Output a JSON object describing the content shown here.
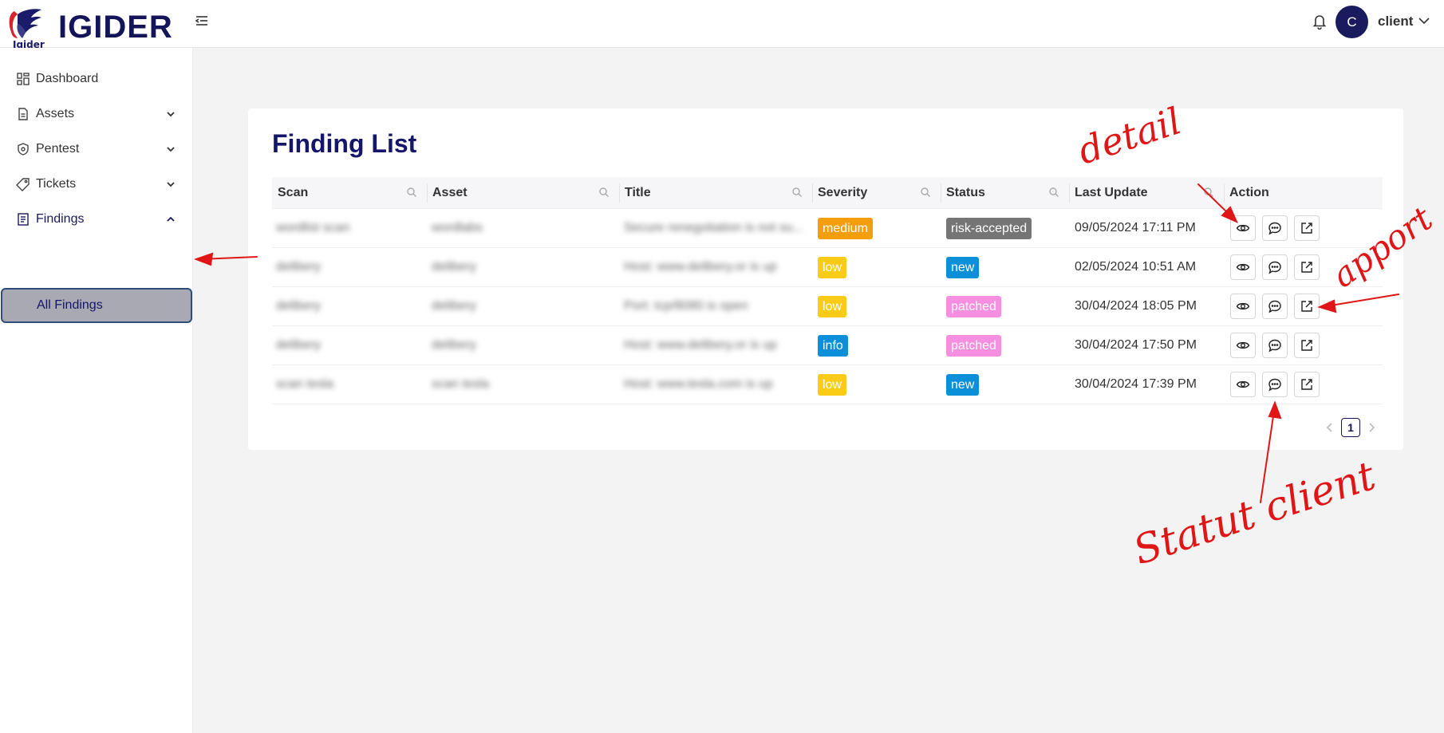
{
  "brand": {
    "name": "IGIDER",
    "logo_text": "Igider"
  },
  "header": {
    "avatar_initial": "C",
    "username": "client"
  },
  "sidebar": {
    "items": [
      {
        "label": "Dashboard",
        "icon": "dashboard-icon"
      },
      {
        "label": "Assets",
        "icon": "file-icon"
      },
      {
        "label": "Pentest",
        "icon": "shield-icon"
      },
      {
        "label": "Tickets",
        "icon": "tag-icon"
      },
      {
        "label": "Findings",
        "icon": "list-icon"
      }
    ],
    "sub_item": "All Findings"
  },
  "main": {
    "title": "Finding List",
    "columns": [
      "Scan",
      "Asset",
      "Title",
      "Severity",
      "Status",
      "Last Update",
      "Action"
    ],
    "rows": [
      {
        "scan": "wordlist scan",
        "asset": "wordlabs",
        "title": "Secure renegotiation is not su...",
        "severity": "medium",
        "status": "risk-accepted",
        "updated": "09/05/2024 17:11 PM"
      },
      {
        "scan": "delibery",
        "asset": "delibery",
        "title": "Host: www.delibery.or is up",
        "severity": "low",
        "status": "new",
        "updated": "02/05/2024 10:51 AM"
      },
      {
        "scan": "delibery",
        "asset": "delibery",
        "title": "Port: tcp/8080 is open",
        "severity": "low",
        "status": "patched",
        "updated": "30/04/2024 18:05 PM"
      },
      {
        "scan": "delibery",
        "asset": "delibery",
        "title": "Host: www.delibery.or is up",
        "severity": "info",
        "status": "patched",
        "updated": "30/04/2024 17:50 PM"
      },
      {
        "scan": "scan tesla",
        "asset": "scan tesla",
        "title": "Host: www.tesla.com is up",
        "severity": "low",
        "status": "new",
        "updated": "30/04/2024 17:39 PM"
      }
    ],
    "page": "1"
  },
  "colors": {
    "medium": "#f59e0b",
    "low": "#facc15",
    "info": "#0b8fd8",
    "risk-accepted": "#757575",
    "new": "#0b8fd8",
    "patched": "#f78fe0"
  },
  "annotations": [
    "detail",
    "apport",
    "Statut client"
  ]
}
